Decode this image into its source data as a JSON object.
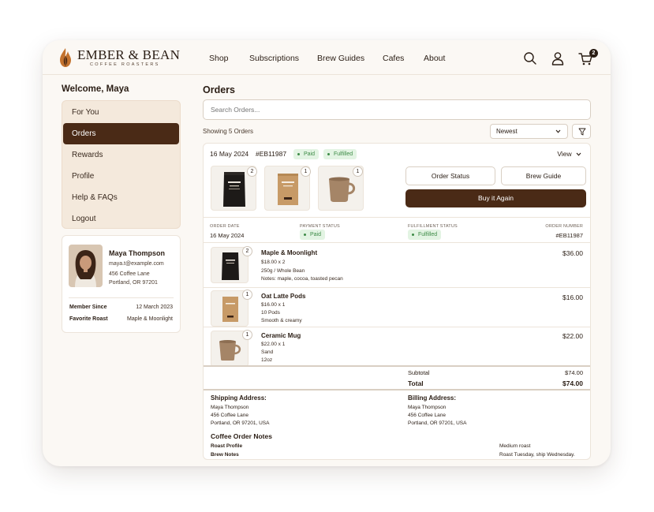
{
  "brand": {
    "name": "EMBER & BEAN",
    "tagline": "COFFEE ROASTERS"
  },
  "nav": [
    "Shop",
    "Subscriptions",
    "Brew Guides",
    "Cafes",
    "About"
  ],
  "header_icons": {
    "search": "search-icon",
    "account": "user-icon",
    "cart": "cart-icon",
    "cart_count": "2"
  },
  "sidebar": {
    "welcome": "Welcome, Maya",
    "menu": [
      "For You",
      "Orders",
      "Rewards",
      "Profile",
      "Help & FAQs",
      "Logout"
    ],
    "active": "Orders",
    "profile": {
      "name": "Maya Thompson",
      "email": "maya.t@example.com",
      "street": "456 Coffee Lane",
      "city": "Portland, OR 97201",
      "member_since_label": "Member Since",
      "member_since": "12 March 2023",
      "favorite_label": "Favorite Roast",
      "favorite": "Maple & Moonlight"
    }
  },
  "main": {
    "title": "Orders",
    "search_placeholder": "Search Orders...",
    "showing": "Showing 5 Orders",
    "sort": "Newest",
    "order": {
      "date": "16 May 2024",
      "number": "#EB11987",
      "payment_badge": "Paid",
      "fulfillment_badge": "Fulfilled",
      "view": "View",
      "thumb_quantities": [
        "2",
        "1",
        "1"
      ],
      "order_status_btn": "Order Status",
      "brew_guide_btn": "Brew Guide",
      "buy_again_btn": "Buy it Again",
      "meta": {
        "order_date_label": "ORDER DATE",
        "payment_status_label": "PAYMENT STATUS",
        "fulfillment_status_label": "FULFILLMENT STATUS",
        "order_number_label": "ORDER NUMBER"
      },
      "items": [
        {
          "qty": "2",
          "name": "Maple & Moonlight",
          "price_line": "$18.00 x 2",
          "detail1": "250g / Whole Bean",
          "detail2": "Notes: maple, cocoa, toasted pecan",
          "total": "$36.00"
        },
        {
          "qty": "1",
          "name": "Oat Latte Pods",
          "price_line": "$16.00 x 1",
          "detail1": "10 Pods",
          "detail2": "Smooth & creamy",
          "total": "$16.00"
        },
        {
          "qty": "1",
          "name": "Ceramic Mug",
          "price_line": "$22.00 x 1",
          "detail1": "Sand",
          "detail2": "12oz",
          "total": "$22.00"
        }
      ],
      "subtotal_label": "Subtotal",
      "subtotal": "$74.00",
      "total_label": "Total",
      "total": "$74.00",
      "shipping": {
        "title": "Shipping Address:",
        "name": "Maya Thompson",
        "street": "456 Coffee Lane",
        "city": "Portland, OR 97201, USA"
      },
      "billing": {
        "title": "Billing Address:",
        "name": "Maya Thompson",
        "street": "456 Coffee Lane",
        "city": "Portland, OR 97201, USA"
      },
      "notes": {
        "title": "Coffee Order Notes",
        "roast_label": "Roast Profile",
        "roast_value": "Medium roast",
        "brew_label": "Brew Notes",
        "brew_value": "Roast Tuesday, ship Wednesday."
      }
    }
  },
  "colors": {
    "accent": "#4a2a16",
    "page_bg": "#fbf8f4",
    "sidebar_bg": "#f4e9dc",
    "success": "#3d8b46"
  }
}
